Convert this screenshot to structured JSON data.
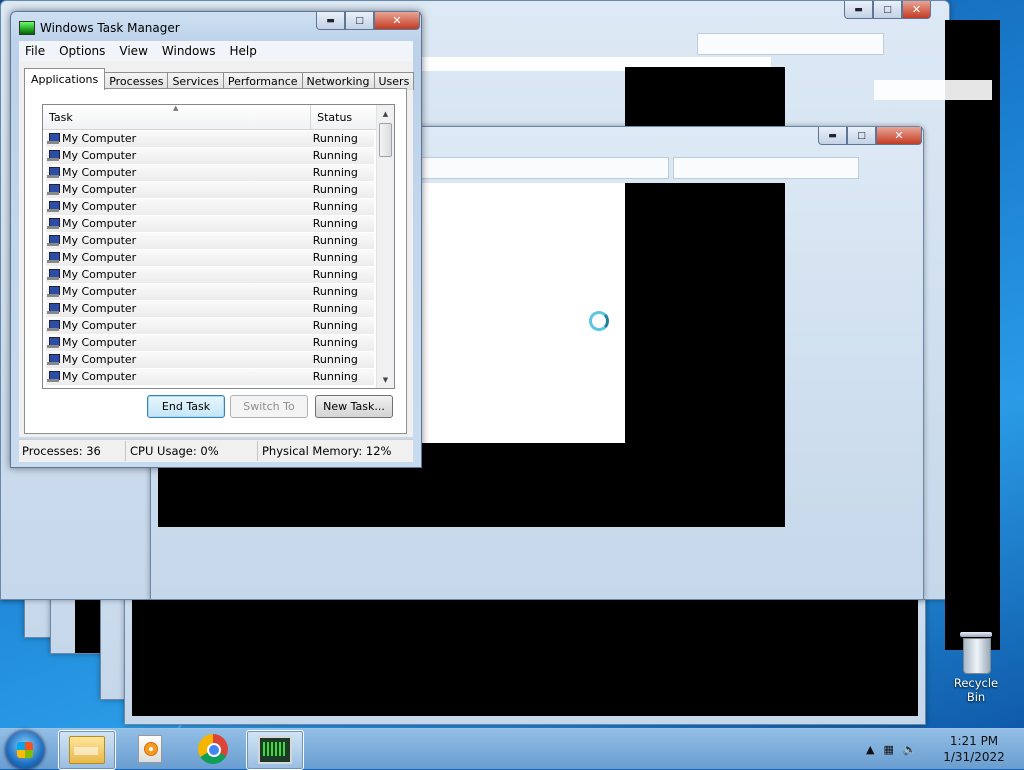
{
  "task_manager": {
    "title": "Windows Task Manager",
    "menu": [
      "File",
      "Options",
      "View",
      "Windows",
      "Help"
    ],
    "tabs": [
      "Applications",
      "Processes",
      "Services",
      "Performance",
      "Networking",
      "Users"
    ],
    "active_tab": "Applications",
    "columns": {
      "task": "Task",
      "status": "Status"
    },
    "rows": [
      {
        "task": "My Computer",
        "status": "Running"
      },
      {
        "task": "My Computer",
        "status": "Running"
      },
      {
        "task": "My Computer",
        "status": "Running"
      },
      {
        "task": "My Computer",
        "status": "Running"
      },
      {
        "task": "My Computer",
        "status": "Running"
      },
      {
        "task": "My Computer",
        "status": "Running"
      },
      {
        "task": "My Computer",
        "status": "Running"
      },
      {
        "task": "My Computer",
        "status": "Running"
      },
      {
        "task": "My Computer",
        "status": "Running"
      },
      {
        "task": "My Computer",
        "status": "Running"
      },
      {
        "task": "My Computer",
        "status": "Running"
      },
      {
        "task": "My Computer",
        "status": "Running"
      },
      {
        "task": "My Computer",
        "status": "Running"
      },
      {
        "task": "My Computer",
        "status": "Running"
      },
      {
        "task": "My Computer",
        "status": "Running"
      }
    ],
    "buttons": {
      "end_task": "End Task",
      "switch_to": "Switch To",
      "new_task": "New Task..."
    },
    "status_bar": {
      "processes": "Processes: 36",
      "cpu": "CPU Usage: 0%",
      "memory": "Physical Memory: 12%"
    }
  },
  "desktop": {
    "recycle_bin_label": "Recycle Bin"
  },
  "taskbar": {
    "pinned": [
      "windows-explorer-icon",
      "media-player-icon",
      "chrome-icon",
      "task-manager-icon"
    ],
    "active_item": "task-manager-icon",
    "clock": {
      "time": "1:21 PM",
      "date": "1/31/2022"
    }
  },
  "colors": {
    "desktop_blue": "#1565b5",
    "close_red": "#c43b22",
    "default_button": "#3c7fb1"
  }
}
